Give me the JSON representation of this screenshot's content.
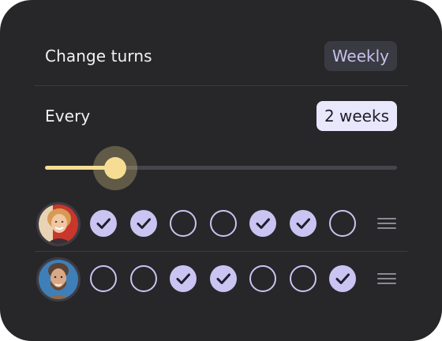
{
  "change_turns": {
    "label": "Change turns",
    "frequency": "Weekly"
  },
  "every": {
    "label": "Every",
    "interval": "2 weeks"
  },
  "slider": {
    "value_fraction": 0.2
  },
  "people": [
    {
      "avatar": "woman-portrait",
      "days": [
        true,
        true,
        false,
        false,
        true,
        true,
        false
      ]
    },
    {
      "avatar": "man-portrait",
      "days": [
        false,
        false,
        true,
        true,
        false,
        false,
        true
      ]
    }
  ],
  "colors": {
    "card": "#27272a",
    "accent_lavender": "#c9c4f1",
    "accent_yellow": "#f6dd93"
  }
}
